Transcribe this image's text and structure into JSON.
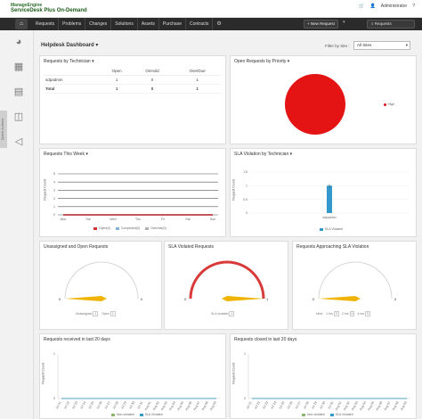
{
  "header": {
    "brand_top": "ManageEngine",
    "brand_product": "ServiceDesk Plus On-Demand",
    "user_label": "Administrator",
    "icons": [
      "cart-icon",
      "user-icon",
      "help-icon"
    ]
  },
  "nav": {
    "items": [
      "Requests",
      "Problems",
      "Changes",
      "Solutions",
      "Assets",
      "Purchase",
      "Contracts"
    ],
    "new_request_label": "+ New Request",
    "search_label": "Requests"
  },
  "sidebar": {
    "tab_label": "Quick Actions",
    "icons": [
      "pie-chart-icon",
      "calendar-icon",
      "document-icon",
      "chart-icon",
      "announcement-icon"
    ]
  },
  "dashboard": {
    "title": "Helpdesk Dashboard",
    "filter_label": "Filter by Site :",
    "filter_value": "All Sites"
  },
  "widgets": {
    "by_technician": {
      "title": "Requests by Technician",
      "columns": [
        "",
        "Open",
        "OnHold",
        "OverDue"
      ],
      "rows": [
        [
          "sdpadmin",
          "1",
          "0",
          "1"
        ],
        [
          "Total",
          "1",
          "0",
          "1"
        ]
      ]
    },
    "by_priority": {
      "title": "Open Requests by Priority",
      "legend": "High",
      "chart_data": {
        "type": "pie",
        "slices": [
          {
            "name": "High",
            "value": 1,
            "color": "#e41414"
          }
        ]
      }
    },
    "this_week": {
      "title": "Requests This Week",
      "ylabel": "Request Count",
      "legend": [
        "Open(0)",
        "Completed(0)",
        "Overdue(0)"
      ],
      "chart_data": {
        "type": "line",
        "categories": [
          "Mon",
          "Tue",
          "Wed",
          "Thu",
          "Fri",
          "Sat",
          "Sun"
        ],
        "ylim": [
          0,
          5
        ],
        "yticks": [
          "5",
          "4",
          "3",
          "2",
          "1",
          "0"
        ],
        "series": [
          {
            "name": "Open(0)",
            "values": [
              0,
              0,
              0,
              0,
              0,
              0,
              0
            ],
            "color": "#cc3333"
          },
          {
            "name": "Completed(0)",
            "values": [
              0,
              0,
              0,
              0,
              0,
              0,
              0
            ],
            "color": "#7fb1d9"
          },
          {
            "name": "Overdue(0)",
            "values": [
              0,
              0,
              0,
              0,
              0,
              0,
              0
            ],
            "color": "#b0b0b0"
          }
        ]
      }
    },
    "sla_by_tech": {
      "title": "SLA Violation by Technician",
      "ylabel": "Request Count",
      "legend": "SLA Violated",
      "chart_data": {
        "type": "bar",
        "categories": [
          "sdpadmin"
        ],
        "values": [
          1
        ],
        "ylim": [
          0,
          1.5
        ],
        "yticks": [
          "1.5",
          "1",
          "0.5",
          "0"
        ],
        "color": "#3399cc"
      }
    },
    "unassigned": {
      "title": "Unassigned and Open Requests",
      "min": "0",
      "max": "0",
      "legend": [
        {
          "name": "Unassigned",
          "value": "1"
        },
        {
          "name": "Open",
          "value": "1"
        }
      ],
      "value_fraction": 0,
      "needle_color": "#f0b400"
    },
    "sla_violated": {
      "title": "SLA Violated Requests",
      "min": "0",
      "max": "1",
      "legend": [
        {
          "name": "SLA violated",
          "value": "1"
        }
      ],
      "value_fraction": 1,
      "arc_color": "#d93a3a"
    },
    "approaching": {
      "title": "Requests Approaching SLA Violation",
      "min": "0",
      "max": "0",
      "legend": [
        {
          "name": "Next",
          "value": ""
        },
        {
          "name": "1 hrs",
          "value": "0"
        },
        {
          "name": "2 hrs",
          "value": "0"
        },
        {
          "name": "4 hrs",
          "value": "0"
        }
      ],
      "value_fraction": 0,
      "needle_color": "#f0b400"
    },
    "received20": {
      "title": "Requests received in last 20 days",
      "ylabel": "Request Count",
      "legend": [
        "Non-violated",
        "SLA Violated"
      ],
      "chart_data": {
        "type": "line",
        "categories": [
          "Jul 21",
          "Jul 22",
          "Jul 23",
          "Jul 24",
          "Jul 25",
          "Jul 26",
          "Jul 27",
          "Jul 28",
          "Jul 29",
          "Jul 30",
          "Jul 31",
          "Aug 01",
          "Aug 02",
          "Aug 03",
          "Aug 04",
          "Aug 05",
          "Aug 06",
          "Aug 07",
          "Aug 08",
          "Aug 09"
        ],
        "ylim": [
          0,
          1
        ],
        "series": [
          {
            "name": "Non-violated",
            "values": [
              0,
              0,
              0,
              0,
              0,
              0,
              0,
              0,
              0,
              0,
              0,
              0,
              0,
              0,
              0,
              0,
              0,
              0,
              0,
              0
            ],
            "color": "#8ab86a"
          },
          {
            "name": "SLA Violated",
            "values": [
              0,
              0,
              0,
              0,
              0,
              0,
              0,
              0,
              0,
              0,
              0,
              0,
              0,
              0,
              0,
              0,
              0,
              0,
              0,
              0
            ],
            "color": "#3399cc"
          }
        ]
      }
    },
    "closed20": {
      "title": "Requests closed in last 20 days",
      "ylabel": "Request Count",
      "legend": [
        "Non-violated",
        "SLA Violated"
      ],
      "chart_data": {
        "type": "line",
        "categories": [
          "Jul 21",
          "Jul 22",
          "Jul 23",
          "Jul 24",
          "Jul 25",
          "Jul 26",
          "Jul 27",
          "Jul 28",
          "Jul 29",
          "Jul 30",
          "Jul 31",
          "Aug 01",
          "Aug 02",
          "Aug 03",
          "Aug 04",
          "Aug 05",
          "Aug 06",
          "Aug 07",
          "Aug 08",
          "Aug 09"
        ],
        "ylim": [
          0,
          1
        ],
        "series": [
          {
            "name": "Non-violated",
            "values": [
              0,
              0,
              0,
              0,
              0,
              0,
              0,
              0,
              0,
              0,
              0,
              0,
              0,
              0,
              0,
              0,
              0,
              0,
              0,
              0
            ],
            "color": "#8ab86a"
          },
          {
            "name": "SLA Violated",
            "values": [
              0,
              0,
              0,
              0,
              0,
              0,
              0,
              0,
              0,
              0,
              0,
              0,
              0,
              0,
              0,
              0,
              0,
              0,
              0,
              0
            ],
            "color": "#3399cc"
          }
        ]
      }
    }
  }
}
